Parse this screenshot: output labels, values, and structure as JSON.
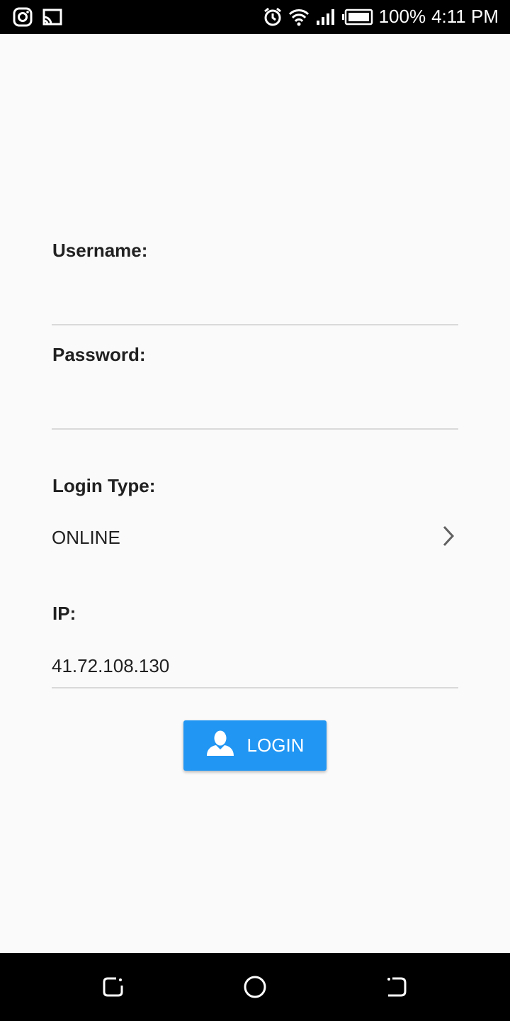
{
  "status_bar": {
    "battery": "100%",
    "time": "4:11 PM",
    "icons": [
      "instagram-icon",
      "cast-icon",
      "alarm-icon",
      "wifi-icon",
      "signal-icon",
      "battery-icon"
    ]
  },
  "form": {
    "username": {
      "label": "Username:",
      "value": ""
    },
    "password": {
      "label": "Password:",
      "value": ""
    },
    "login_type": {
      "label": "Login Type:",
      "value": "ONLINE",
      "icon": "chevron-right-icon"
    },
    "ip": {
      "label": "IP:",
      "value": "41.72.108.130"
    }
  },
  "login_button": {
    "label": "LOGIN",
    "icon": "person-icon",
    "color": "#2196f3"
  },
  "nav_bar": {
    "icons": [
      "recents-icon",
      "home-icon",
      "back-icon"
    ]
  }
}
